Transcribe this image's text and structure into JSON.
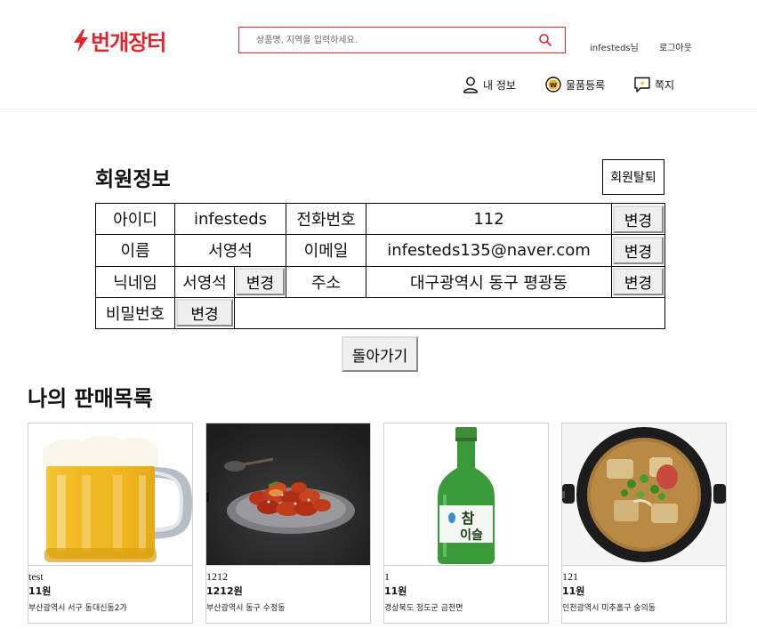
{
  "header": {
    "logo_text": "번개장터",
    "search_placeholder": "상품명, 지역을 입력하세요.",
    "user_name": "infesteds님",
    "logout_label": "로그아웃",
    "nav": {
      "my_info": "내 정보",
      "register_item": "물품등록",
      "messages": "쪽지"
    }
  },
  "member": {
    "title": "회원정보",
    "withdraw_label": "회원탈퇴",
    "change_label": "변경",
    "fields": {
      "id_label": "아이디",
      "id_value": "infesteds",
      "phone_label": "전화번호",
      "phone_value": "112",
      "name_label": "이름",
      "name_value": "서영석",
      "email_label": "이메일",
      "email_value": "infesteds135@naver.com",
      "nickname_label": "닉네임",
      "nickname_value": "서영석",
      "address_label": "주소",
      "address_value": "대구광역시 동구 평광동",
      "password_label": "비밀번호"
    },
    "back_label": "돌아가기"
  },
  "sales": {
    "title": "나의 판매목록",
    "items": [
      {
        "name": "test",
        "price": "11원",
        "location": "부산광역시 서구 동대신동2가",
        "image": "beer-mug"
      },
      {
        "name": "1212",
        "price": "1212원",
        "location": "부산광역시 동구 수정동",
        "image": "spicy-chicken"
      },
      {
        "name": "1",
        "price": "11원",
        "location": "경상북도 청도군 금천면",
        "image": "soju-bottle"
      },
      {
        "name": "121",
        "price": "11원",
        "location": "인천광역시 미추홀구 숭의동",
        "image": "stew-pot"
      }
    ]
  },
  "colors": {
    "brand": "#e0262c",
    "border": "#000000"
  }
}
